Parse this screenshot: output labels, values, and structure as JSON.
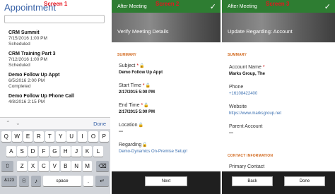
{
  "screen1": {
    "label": "Screen 1",
    "title": "Appointment",
    "keyboard_done": "Done",
    "items": [
      {
        "title": "CRM Summit",
        "date": "7/15/2016 1:00 PM",
        "status": "Scheduled"
      },
      {
        "title": "CRM Training Part 3",
        "date": "7/12/2016 1:00 PM",
        "status": "Scheduled"
      },
      {
        "title": "Demo Follow Up Appt",
        "date": "6/5/2016 2:00 PM",
        "status": "Completed"
      },
      {
        "title": "Demo Follow Up Phone Call",
        "date": "4/8/2016 2:15 PM",
        "status": ""
      }
    ],
    "keys_row1": [
      "Q",
      "W",
      "E",
      "R",
      "T",
      "Y",
      "U",
      "I",
      "O",
      "P"
    ],
    "keys_row2": [
      "A",
      "S",
      "D",
      "F",
      "G",
      "H",
      "J",
      "K",
      "L"
    ],
    "keys_row3": [
      "Z",
      "X",
      "C",
      "V",
      "B",
      "N",
      "M"
    ],
    "key_num": "&123",
    "key_space": "space",
    "key_period": "."
  },
  "screen2": {
    "label": "Screen 2",
    "header_title": "After Meeting",
    "banner_title": "Verify Meeting Details",
    "section": "SUMMARY",
    "subject_label": "Subject",
    "subject_value": "Demo Follow Up Appt",
    "start_label": "Start Time",
    "start_value": "2/17/2015 5:00 PM",
    "end_label": "End Time",
    "end_value": "2/17/2015 5:00 PM",
    "location_label": "Location",
    "location_value": "---",
    "regarding_label": "Regarding",
    "regarding_value": "Demo-Dynamics On-Premise Setup!",
    "next_label": "Next"
  },
  "screen3": {
    "label": "Screen 3",
    "header_title": "After Meeting",
    "banner_title": "Update Regarding: Account",
    "section": "SUMMARY",
    "account_label": "Account Name",
    "account_value": "Marks Group, The",
    "phone_label": "Phone",
    "phone_value": "+16108422400",
    "website_label": "Website",
    "website_value": "https://www.marksgroup.net",
    "parent_label": "Parent Account",
    "parent_value": "---",
    "contact_section": "CONTACT INFORMATION",
    "primary_label": "Primary Contact",
    "back_label": "Back",
    "done_label": "Done"
  },
  "colors": {
    "header_green": "#2e7d32",
    "accent_orange": "#d2691e",
    "link_blue": "#3a6fb0",
    "label_red": "#e8141e"
  }
}
